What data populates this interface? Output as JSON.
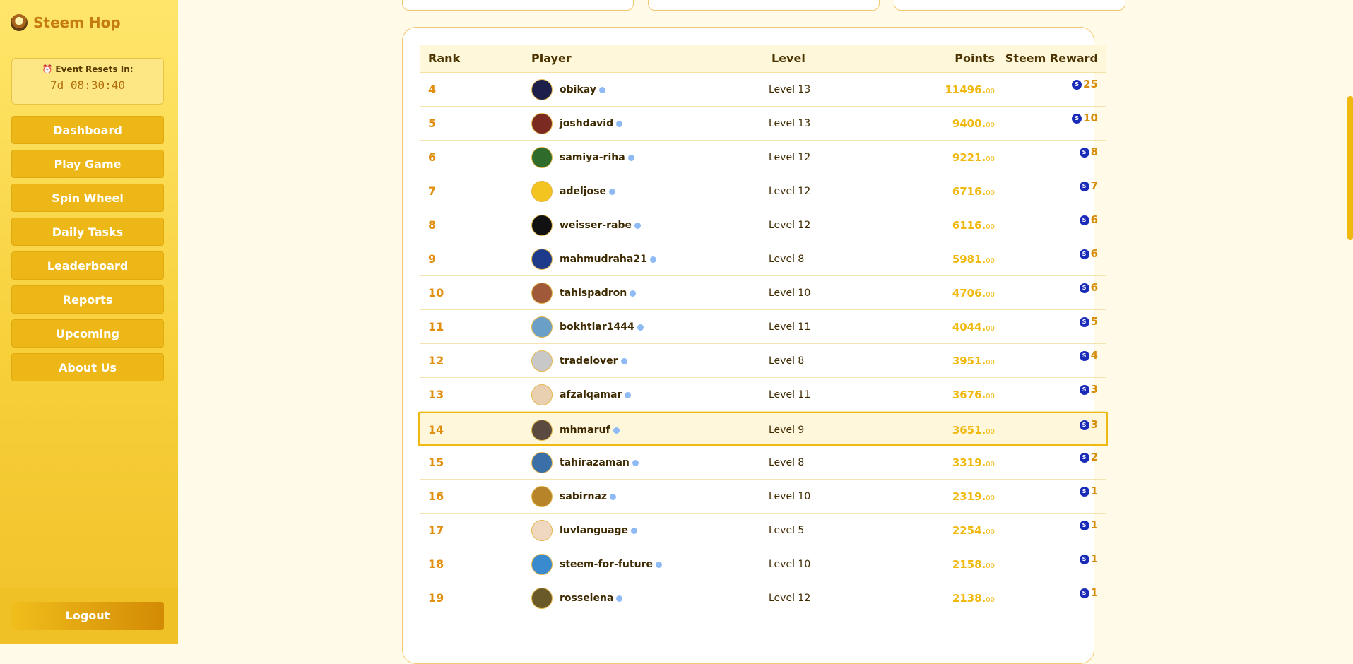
{
  "brand": {
    "name": "Steem Hop"
  },
  "event": {
    "title": "Event Resets In:",
    "time": "7d 08:30:40"
  },
  "nav": [
    "Dashboard",
    "Play Game",
    "Spin Wheel",
    "Daily Tasks",
    "Leaderboard",
    "Reports",
    "Upcoming",
    "About Us"
  ],
  "logout": "Logout",
  "table": {
    "headers": {
      "rank": "Rank",
      "player": "Player",
      "level": "Level",
      "points": "Points",
      "reward": "Steem Reward"
    },
    "rows": [
      {
        "rank": "4",
        "player": "obikay",
        "level": "Level 13",
        "points": "11496.",
        "dec": "00",
        "reward": "25",
        "avatar_color": "#1b1f4a"
      },
      {
        "rank": "5",
        "player": "joshdavid",
        "level": "Level 13",
        "points": "9400.",
        "dec": "00",
        "reward": "10",
        "avatar_color": "#7a2a20"
      },
      {
        "rank": "6",
        "player": "samiya-riha",
        "level": "Level 12",
        "points": "9221.",
        "dec": "00",
        "reward": "8",
        "avatar_color": "#2f6b2a"
      },
      {
        "rank": "7",
        "player": "adeljose",
        "level": "Level 12",
        "points": "6716.",
        "dec": "00",
        "reward": "7",
        "avatar_color": "#f3c320"
      },
      {
        "rank": "8",
        "player": "weisser-rabe",
        "level": "Level 12",
        "points": "6116.",
        "dec": "00",
        "reward": "6",
        "avatar_color": "#111111"
      },
      {
        "rank": "9",
        "player": "mahmudraha21",
        "level": "Level 8",
        "points": "5981.",
        "dec": "00",
        "reward": "6",
        "avatar_color": "#1e3a8a"
      },
      {
        "rank": "10",
        "player": "tahispadron",
        "level": "Level 10",
        "points": "4706.",
        "dec": "00",
        "reward": "6",
        "avatar_color": "#a05a3a"
      },
      {
        "rank": "11",
        "player": "bokhtiar1444",
        "level": "Level 11",
        "points": "4044.",
        "dec": "00",
        "reward": "5",
        "avatar_color": "#6aa0c8"
      },
      {
        "rank": "12",
        "player": "tradelover",
        "level": "Level 8",
        "points": "3951.",
        "dec": "00",
        "reward": "4",
        "avatar_color": "#c8c8c8"
      },
      {
        "rank": "13",
        "player": "afzalqamar",
        "level": "Level 11",
        "points": "3676.",
        "dec": "00",
        "reward": "3",
        "avatar_color": "#e8d0b0"
      },
      {
        "rank": "14",
        "player": "mhmaruf",
        "level": "Level 9",
        "points": "3651.",
        "dec": "00",
        "reward": "3",
        "avatar_color": "#5a4a40",
        "highlight": true
      },
      {
        "rank": "15",
        "player": "tahirazaman",
        "level": "Level 8",
        "points": "3319.",
        "dec": "00",
        "reward": "2",
        "avatar_color": "#3a6fa8"
      },
      {
        "rank": "16",
        "player": "sabirnaz",
        "level": "Level 10",
        "points": "2319.",
        "dec": "00",
        "reward": "1",
        "avatar_color": "#b8842a"
      },
      {
        "rank": "17",
        "player": "luvlanguage",
        "level": "Level 5",
        "points": "2254.",
        "dec": "00",
        "reward": "1",
        "avatar_color": "#f0d8c0"
      },
      {
        "rank": "18",
        "player": "steem-for-future",
        "level": "Level 10",
        "points": "2158.",
        "dec": "00",
        "reward": "1",
        "avatar_color": "#3a8ad0"
      },
      {
        "rank": "19",
        "player": "rosselena",
        "level": "Level 12",
        "points": "2138.",
        "dec": "00",
        "reward": "1",
        "avatar_color": "#6a5a2a"
      }
    ]
  },
  "colors": {
    "accent": "#f0b90f",
    "rank": "#e08f0e",
    "steem": "#1a2bb8"
  }
}
